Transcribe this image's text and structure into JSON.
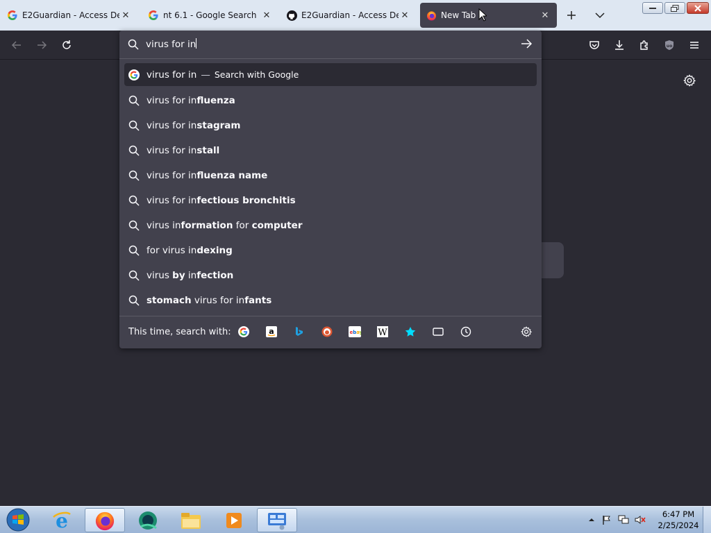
{
  "tabs": [
    {
      "title": "E2Guardian - Access Denie",
      "favicon": "google-g-icon"
    },
    {
      "title": "nt 6.1 - Google Search",
      "favicon": "google-g-icon"
    },
    {
      "title": "E2Guardian - Access Denie",
      "favicon": "github-icon"
    },
    {
      "title": "New Tab",
      "favicon": "firefox-icon",
      "active": true
    }
  ],
  "urlbar": {
    "value": "virus for in",
    "selected": {
      "typed": "virus for in",
      "dash": "—",
      "action": "Search with Google"
    },
    "suggestions": [
      [
        {
          "t": "virus for in",
          "b": false
        },
        {
          "t": "fluenza",
          "b": true
        }
      ],
      [
        {
          "t": "virus for in",
          "b": false
        },
        {
          "t": "stagram",
          "b": true
        }
      ],
      [
        {
          "t": "virus for in",
          "b": false
        },
        {
          "t": "stall",
          "b": true
        }
      ],
      [
        {
          "t": "virus for in",
          "b": false
        },
        {
          "t": "fluenza name",
          "b": true
        }
      ],
      [
        {
          "t": "virus for in",
          "b": false
        },
        {
          "t": "fectious bronchitis",
          "b": true
        }
      ],
      [
        {
          "t": "virus in",
          "b": false
        },
        {
          "t": "formation",
          "b": true
        },
        {
          "t": " for ",
          "b": false
        },
        {
          "t": "computer",
          "b": true
        }
      ],
      [
        {
          "t": "for virus in",
          "b": false
        },
        {
          "t": "dexing",
          "b": true
        }
      ],
      [
        {
          "t": "virus ",
          "b": false
        },
        {
          "t": "by",
          "b": true
        },
        {
          "t": " in",
          "b": false
        },
        {
          "t": "fection",
          "b": true
        }
      ],
      [
        {
          "t": "stomach",
          "b": true
        },
        {
          "t": " virus for in",
          "b": false
        },
        {
          "t": "fants",
          "b": true
        }
      ]
    ],
    "oneoff_label": "This time, search with:",
    "engines": [
      "google-icon",
      "amazon-icon",
      "bing-icon",
      "duckduckgo-icon",
      "ebay-icon",
      "wikipedia-icon",
      "bookmarks-icon",
      "tabs-icon",
      "history-icon"
    ]
  },
  "taskbar": {
    "apps": [
      "internet-explorer-icon",
      "firefox-icon",
      "app-icon",
      "file-explorer-icon",
      "media-player-icon",
      "network-app-icon"
    ],
    "time": "6:47 PM",
    "date": "2/25/2024"
  },
  "colors": {
    "accent": "#42414d",
    "background": "#2b2a33",
    "tabstrip": "#dee7f2"
  }
}
